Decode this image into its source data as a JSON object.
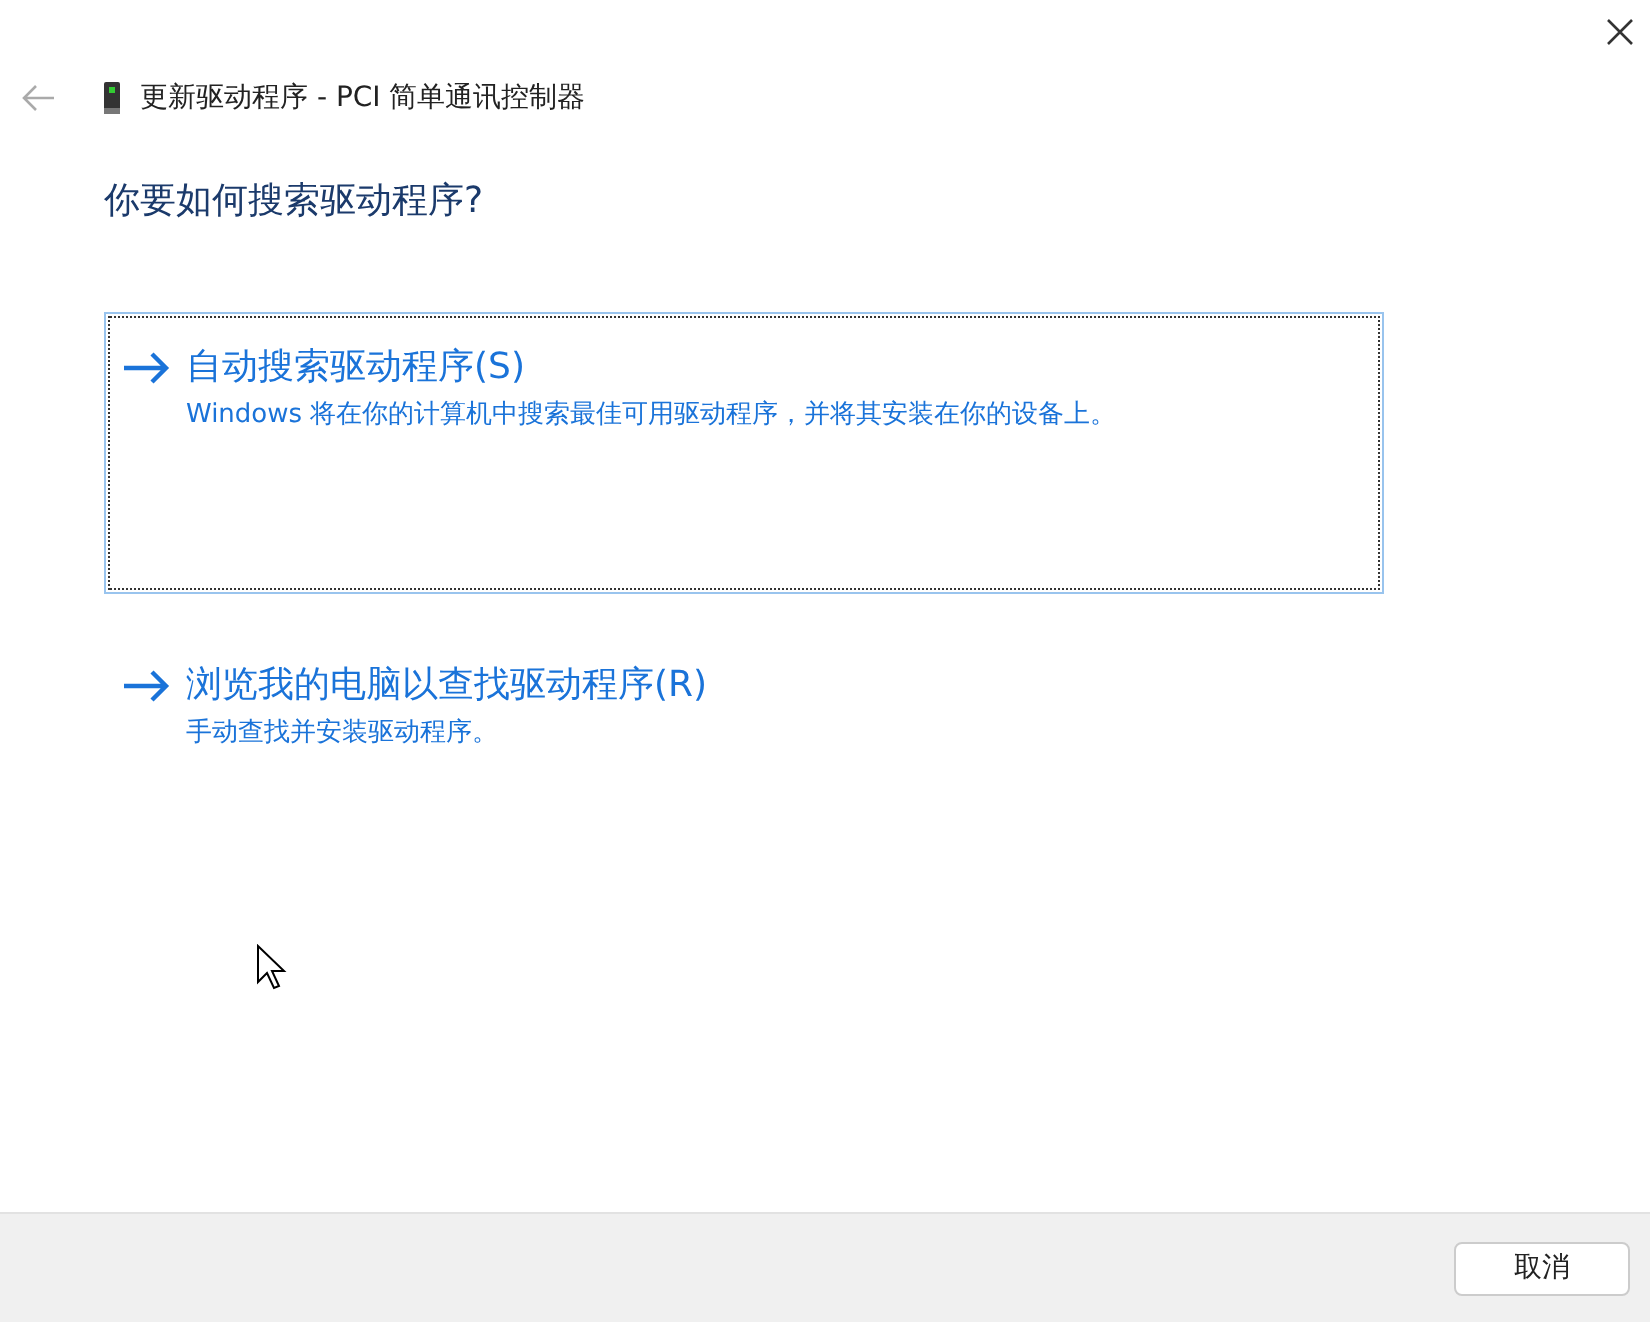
{
  "window": {
    "title": "更新驱动程序 - PCI 简单通讯控制器"
  },
  "heading": "你要如何搜索驱动程序?",
  "options": [
    {
      "title": "自动搜索驱动程序(S)",
      "description": "Windows 将在你的计算机中搜索最佳可用驱动程序，并将其安装在你的设备上。",
      "selected": true
    },
    {
      "title": "浏览我的电脑以查找驱动程序(R)",
      "description": "手动查找并安装驱动程序。",
      "selected": false
    }
  ],
  "buttons": [
    "取消"
  ]
}
